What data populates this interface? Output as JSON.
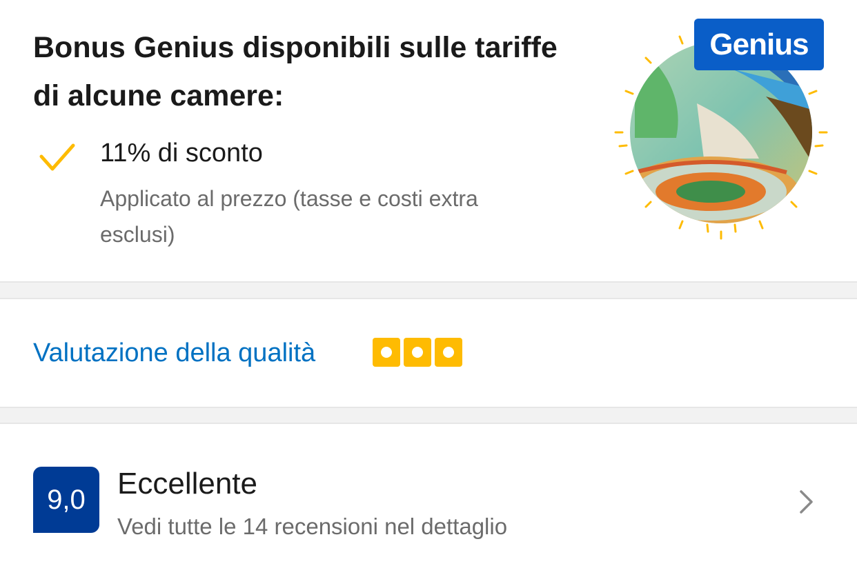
{
  "genius": {
    "title": "Bonus Genius disponibili sulle tariffe di alcune camere:",
    "benefit": "11% di sconto",
    "benefit_detail": "Applicato al prezzo (tasse e costi extra esclusi)",
    "badge_label": "Genius",
    "icon": "checkmark-icon",
    "accent_color": "#febb02",
    "badge_color": "#0a5ec8"
  },
  "quality": {
    "label": "Valutazione della qualità",
    "rating": 3,
    "link_color": "#0071c2"
  },
  "review": {
    "score": "9,0",
    "verdict": "Eccellente",
    "link_text": "Vedi tutte le 14 recensioni nel dettaglio",
    "icon": "chevron-right-icon",
    "badge_color": "#003b95"
  }
}
